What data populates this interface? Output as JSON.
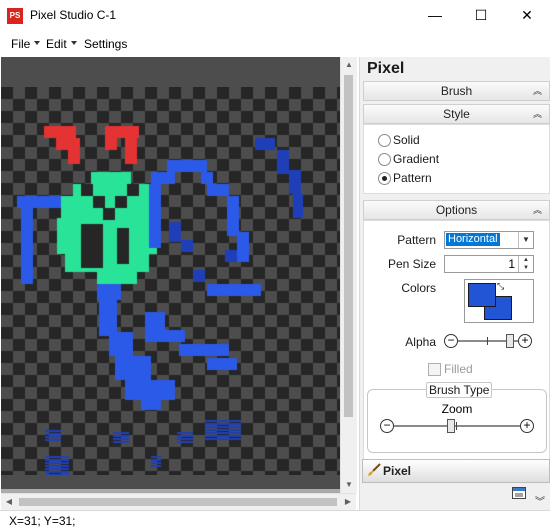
{
  "window": {
    "title": "Pixel Studio C-1",
    "app_icon_text": "PS",
    "min_glyph": "—",
    "max_glyph": "☐",
    "close_glyph": "✕"
  },
  "menu": {
    "items": [
      {
        "label": "File",
        "has_arrow": true
      },
      {
        "label": "Edit",
        "has_arrow": true
      },
      {
        "label": "Settings",
        "has_arrow": false
      }
    ]
  },
  "status": {
    "coords": "X=31; Y=31;"
  },
  "panel": {
    "title": "Pixel",
    "brush_header": "Brush",
    "style_header": "Style",
    "style_options": [
      {
        "label": "Solid",
        "selected": false
      },
      {
        "label": "Gradient",
        "selected": false
      },
      {
        "label": "Pattern",
        "selected": true
      }
    ],
    "options_header": "Options",
    "pattern_label": "Pattern",
    "pattern_value": "Horizontal",
    "pen_size_label": "Pen Size",
    "pen_size_value": "1",
    "colors_label": "Colors",
    "primary_color": "#2155d6",
    "secondary_color": "#2155d6",
    "alpha_label": "Alpha",
    "alpha_level": 0.93,
    "filled_label": "Filled",
    "filled_checked": false,
    "brush_type_label": "Brush Type",
    "zoom_label": "Zoom",
    "zoom_level": 0.45,
    "tab_label": "Pixel"
  },
  "colors": {
    "red": "#e53232",
    "green": "#28e398",
    "blue": "#2c5ae8",
    "dark_blue": "#1f3fb8",
    "checker_dark": "#262626",
    "checker_light": "#4d4d4d"
  }
}
